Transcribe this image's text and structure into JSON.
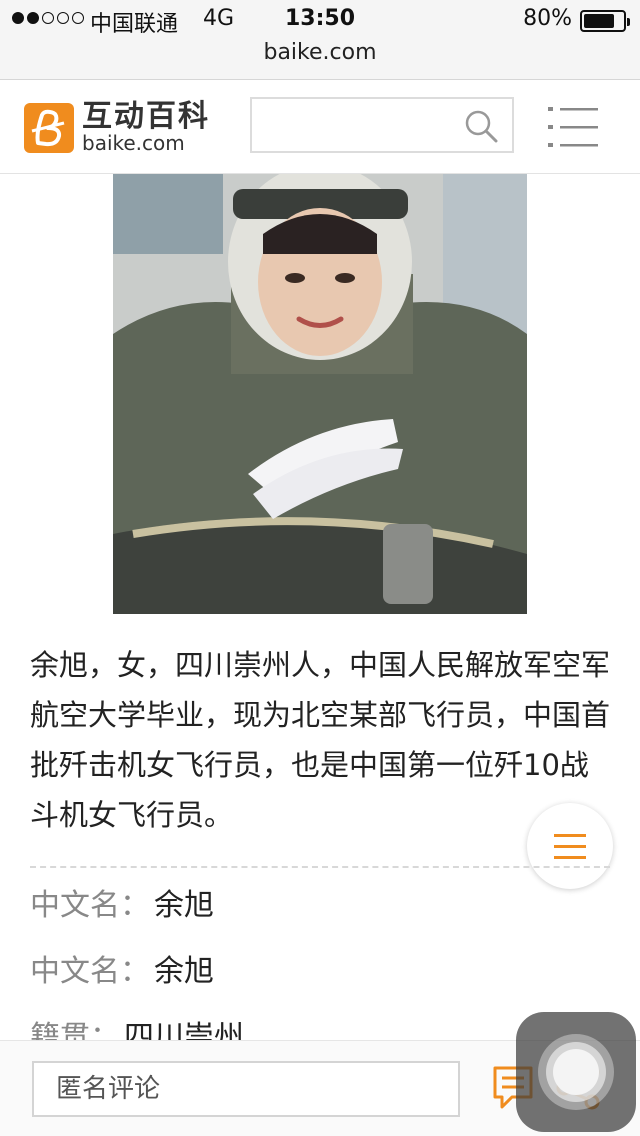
{
  "status_bar": {
    "carrier": "中国联通",
    "network": "4G",
    "time": "13:50",
    "battery_percent": "80%",
    "battery_level": 0.8
  },
  "address_bar": {
    "url": "baike.com"
  },
  "header": {
    "logo_cn": "互动百科",
    "logo_en": "baike.com",
    "search_placeholder": "",
    "icons": {
      "search": "search-icon",
      "menu": "menu-icon"
    },
    "brand_color": "#f08c1e"
  },
  "article": {
    "summary": "余旭，女，四川崇州人，中国人民解放军空军航空大学毕业，现为北空某部飞行员，中国首批歼击机女飞行员，也是中国第一位歼10战斗机女飞行员。",
    "info": [
      {
        "label": "中文名：",
        "value": "余旭"
      },
      {
        "label": "中文名：",
        "value": "余旭"
      },
      {
        "label": "籍贯：",
        "value": "四川崇州"
      }
    ]
  },
  "bottom_bar": {
    "comment_placeholder": "匿名评论",
    "icons": {
      "comment": "comment-icon",
      "share": "share-icon"
    }
  },
  "floating_button": {
    "icon": "list-menu-icon",
    "color": "#f08c1e"
  }
}
